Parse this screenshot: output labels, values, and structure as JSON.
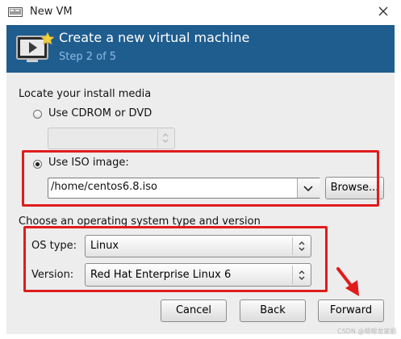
{
  "window": {
    "title": "New VM"
  },
  "header": {
    "title": "Create a new virtual machine",
    "step": "Step 2 of 5"
  },
  "install_media": {
    "heading": "Locate your install media",
    "cdrom_label": "Use CDROM or DVD",
    "iso_label": "Use ISO image:",
    "iso_path": "/home/centos6.8.iso",
    "browse_label": "Browse...",
    "selected": "iso"
  },
  "os": {
    "heading": "Choose an operating system type and version",
    "type_label": "OS type:",
    "type_value": "Linux",
    "version_label": "Version:",
    "version_value": "Red Hat Enterprise Linux 6"
  },
  "buttons": {
    "cancel": "Cancel",
    "back": "Back",
    "forward": "Forward"
  },
  "watermark": "CSDN @嗯嗯龙家丽",
  "colors": {
    "banner": "#1f5d8f",
    "annotation": "#e01c1c"
  },
  "icons": [
    "vm-window-icon",
    "close-icon",
    "monitor-star-icon",
    "chevron-down-icon",
    "spin-arrows-icon",
    "arrow-annotation-icon"
  ]
}
